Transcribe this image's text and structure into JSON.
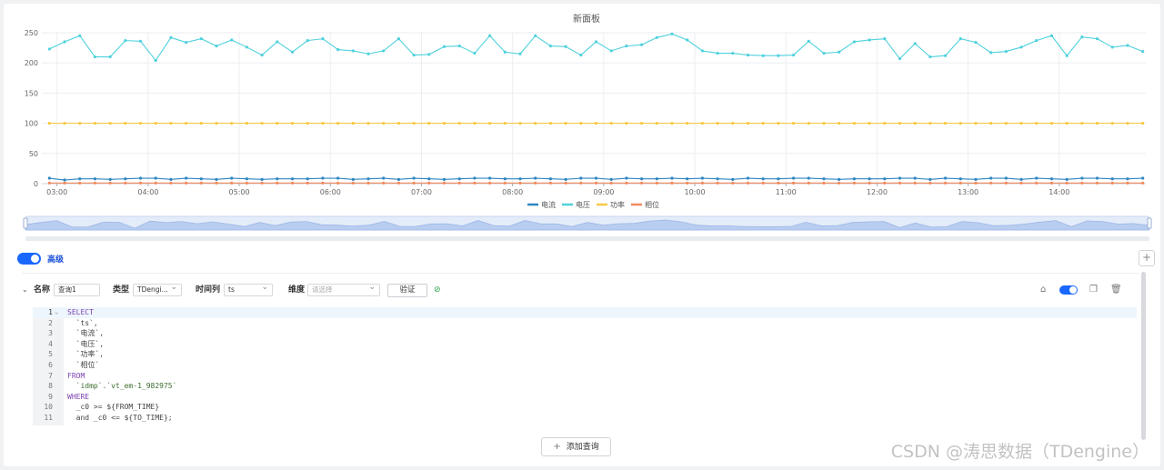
{
  "dashboard": {
    "title": "新面板"
  },
  "chart_data": {
    "type": "line",
    "title": "新面板",
    "xlabel": "",
    "ylabel": "",
    "ylim": [
      0,
      250
    ],
    "yticks": [
      0,
      50,
      100,
      150,
      200,
      250
    ],
    "xticks": [
      "03:00",
      "04:00",
      "05:00",
      "06:00",
      "07:00",
      "08:00",
      "09:00",
      "10:00",
      "11:00",
      "12:00",
      "13:00",
      "14:00"
    ],
    "grid": true,
    "legend_position": "bottom",
    "x": [
      "02:55",
      "03:05",
      "03:15",
      "03:25",
      "03:35",
      "03:45",
      "03:55",
      "04:05",
      "04:15",
      "04:25",
      "04:35",
      "04:45",
      "04:55",
      "05:05",
      "05:15",
      "05:25",
      "05:35",
      "05:45",
      "05:55",
      "06:05",
      "06:15",
      "06:25",
      "06:35",
      "06:45",
      "06:55",
      "07:05",
      "07:15",
      "07:25",
      "07:35",
      "07:45",
      "07:55",
      "08:05",
      "08:15",
      "08:25",
      "08:35",
      "08:45",
      "08:55",
      "09:05",
      "09:15",
      "09:25",
      "09:35",
      "09:45",
      "09:55",
      "10:05",
      "10:15",
      "10:25",
      "10:35",
      "10:45",
      "10:55",
      "11:05",
      "11:15",
      "11:25",
      "11:35",
      "11:45",
      "11:55",
      "12:05",
      "12:15",
      "12:25",
      "12:35",
      "12:45",
      "12:55",
      "13:05",
      "13:15",
      "13:25",
      "13:35",
      "13:45",
      "13:55",
      "14:05",
      "14:15",
      "14:25",
      "14:35",
      "14:45",
      "14:55"
    ],
    "series": [
      {
        "name": "电流",
        "color": "#2e86c1",
        "values": [
          9,
          6,
          8,
          8,
          7,
          8,
          9,
          9,
          7,
          9,
          8,
          7,
          9,
          8,
          7,
          8,
          8,
          8,
          9,
          9,
          7,
          8,
          9,
          7,
          9,
          8,
          7,
          8,
          9,
          9,
          8,
          8,
          9,
          8,
          7,
          9,
          9,
          7,
          9,
          8,
          8,
          9,
          8,
          9,
          8,
          7,
          9,
          8,
          8,
          9,
          9,
          8,
          7,
          8,
          8,
          8,
          9,
          9,
          7,
          9,
          8,
          7,
          9,
          9,
          7,
          9,
          8,
          7,
          9,
          9,
          8,
          8,
          9
        ]
      },
      {
        "name": "电压",
        "color": "#4fd1dd",
        "values": [
          223,
          235,
          245,
          210,
          210,
          237,
          236,
          204,
          242,
          234,
          240,
          228,
          238,
          226,
          213,
          235,
          218,
          237,
          240,
          222,
          220,
          215,
          220,
          240,
          213,
          214,
          227,
          228,
          216,
          245,
          218,
          215,
          245,
          228,
          227,
          213,
          235,
          220,
          228,
          230,
          242,
          248,
          238,
          220,
          216,
          216,
          213,
          212,
          212,
          213,
          236,
          216,
          218,
          235,
          238,
          240,
          207,
          232,
          210,
          212,
          240,
          234,
          217,
          219,
          226,
          237,
          245,
          212,
          243,
          240,
          226,
          229,
          219
        ]
      },
      {
        "name": "功率",
        "color": "#f7c945",
        "values": [
          100,
          100,
          100,
          100,
          100,
          100,
          100,
          100,
          100,
          100,
          100,
          100,
          100,
          100,
          100,
          100,
          100,
          100,
          100,
          100,
          100,
          100,
          100,
          100,
          100,
          100,
          100,
          100,
          100,
          100,
          100,
          100,
          100,
          100,
          100,
          100,
          100,
          100,
          100,
          100,
          100,
          100,
          100,
          100,
          100,
          100,
          100,
          100,
          100,
          100,
          100,
          100,
          100,
          100,
          100,
          100,
          100,
          100,
          100,
          100,
          100,
          100,
          100,
          100,
          100,
          100,
          100,
          100,
          100,
          100,
          100,
          100,
          100
        ]
      },
      {
        "name": "相位",
        "color": "#f08a5d",
        "values": [
          1,
          1,
          1,
          1,
          1,
          1,
          1,
          1,
          1,
          1,
          1,
          1,
          1,
          1,
          1,
          1,
          1,
          1,
          1,
          1,
          1,
          1,
          1,
          1,
          1,
          1,
          1,
          1,
          1,
          1,
          1,
          1,
          1,
          1,
          1,
          1,
          1,
          1,
          1,
          1,
          1,
          1,
          1,
          1,
          1,
          1,
          1,
          1,
          1,
          1,
          1,
          1,
          1,
          1,
          1,
          1,
          1,
          1,
          1,
          1,
          1,
          1,
          1,
          1,
          1,
          1,
          1,
          1,
          1,
          1,
          1,
          1,
          1
        ]
      }
    ]
  },
  "settings": {
    "advanced_label": "高级",
    "add_panel_icon": "plus-icon"
  },
  "query": {
    "name_label": "名称",
    "name_value": "查询1",
    "type_label": "类型",
    "type_value": "TDengi...",
    "timecol_label": "时间列",
    "timecol_value": "ts",
    "dimension_label": "维度",
    "dimension_placeholder": "请选择",
    "verify_label": "验证",
    "code_lines": [
      "SELECT",
      "  `ts`,",
      "  `电流`,",
      "  `电压`,",
      "  `功率`,",
      "  `相位`",
      "FROM",
      "  `idmp`.`vt_em-1_982975`",
      "WHERE",
      "  _c0 >= ${FROM_TIME}",
      "  and _c0 <= ${TO_TIME};"
    ],
    "line_numbers": [
      "1",
      "2",
      "3",
      "4",
      "5",
      "6",
      "7",
      "8",
      "9",
      "10",
      "11"
    ]
  },
  "add_query_label": "添加查询",
  "watermark": "CSDN @涛思数据（TDengine）"
}
